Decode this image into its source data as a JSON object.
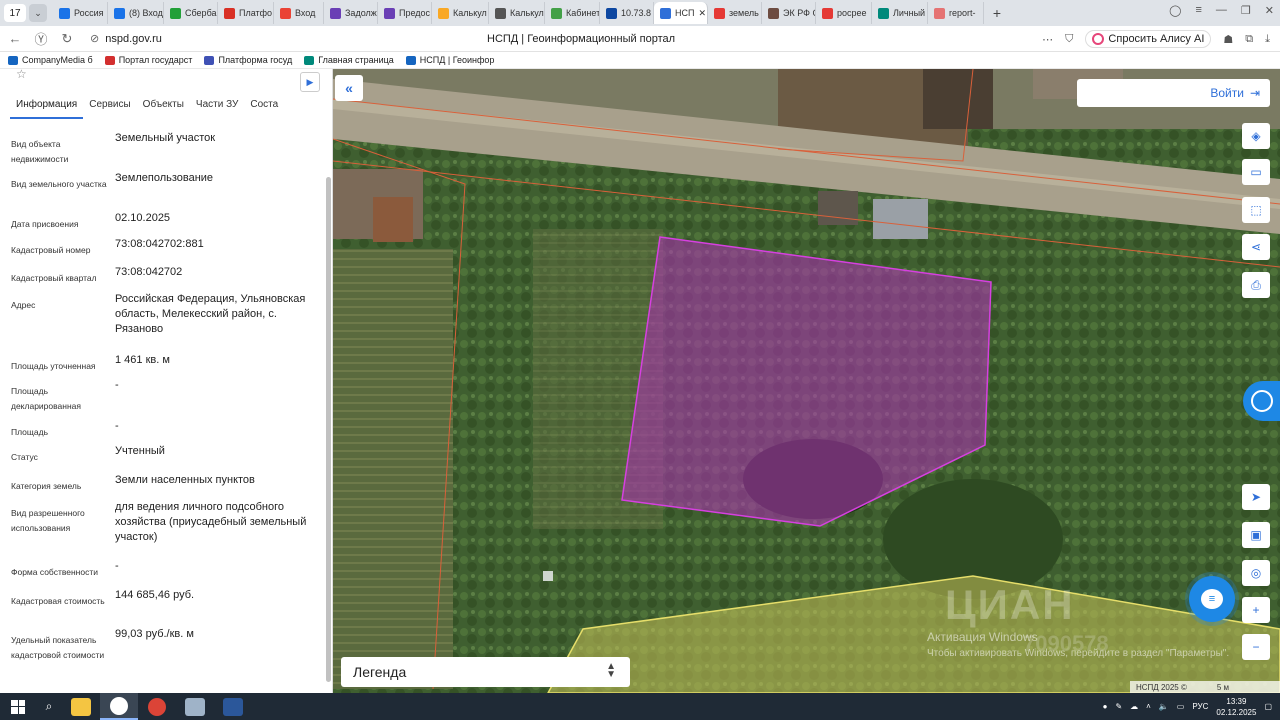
{
  "browser": {
    "tab_counter": "17",
    "tabs": [
      {
        "label": "Россия",
        "color": "#1a73e8"
      },
      {
        "label": "(8) Вход",
        "color": "#1a73e8"
      },
      {
        "label": "Сберба",
        "color": "#21a038"
      },
      {
        "label": "Платфо",
        "color": "#d93025"
      },
      {
        "label": "Вход",
        "color": "#ea4335"
      },
      {
        "label": "Задолж",
        "color": "#6a3fb5"
      },
      {
        "label": "Предос",
        "color": "#6a3fb5"
      },
      {
        "label": "Калькул",
        "color": "#f9a825"
      },
      {
        "label": "Калькул",
        "color": "#555555"
      },
      {
        "label": "Кабинет",
        "color": "#43a047"
      },
      {
        "label": "10.73.8",
        "color": "#0d47a1"
      },
      {
        "label": "НСП",
        "color": "#2f6fd8",
        "active": true
      },
      {
        "label": "земель",
        "color": "#e53935"
      },
      {
        "label": "ЭК РФ С",
        "color": "#6d4c41"
      },
      {
        "label": "росрее",
        "color": "#e53935"
      },
      {
        "label": "Личный",
        "color": "#00897b"
      },
      {
        "label": "report-",
        "color": "#e57373"
      }
    ],
    "tab_close": "✕",
    "tab_add": "+",
    "url": "nspd.gov.ru",
    "page_title": "НСПД | Геоинформационный портал",
    "alisa_label": "Спросить Алису AI",
    "bookmarks": [
      {
        "label": "CompanyMedia б",
        "color": "#1565c0"
      },
      {
        "label": "Портал государст",
        "color": "#d32f2f"
      },
      {
        "label": "Платформа госуд",
        "color": "#3f51b5"
      },
      {
        "label": "Главная страница",
        "color": "#00897b"
      },
      {
        "label": "НСПД | Геоинфор",
        "color": "#1565c0"
      }
    ]
  },
  "panel": {
    "tabs": [
      "Информация",
      "Сервисы",
      "Объекты",
      "Части ЗУ",
      "Соста"
    ],
    "active_tab": "Информация",
    "properties": [
      {
        "label": "Вид объекта недвижимости",
        "value": "Земельный участок"
      },
      {
        "label": "Вид земельного участка",
        "value": "Землепользование"
      },
      {
        "label": "Дата присвоения",
        "value": "02.10.2025"
      },
      {
        "label": "Кадастровый номер",
        "value": "73:08:042702:881"
      },
      {
        "label": "Кадастровый квартал",
        "value": "73:08:042702"
      },
      {
        "label": "Адрес",
        "value": "Российская Федерация, Ульяновская область, Мелекесский район, с. Рязаново"
      },
      {
        "label": "Площадь уточненная",
        "value": "1 461 кв. м"
      },
      {
        "label": "Площадь декларированная",
        "value": "-"
      },
      {
        "label": "Площадь",
        "value": "-"
      },
      {
        "label": "Статус",
        "value": "Учтенный"
      },
      {
        "label": "Категория земель",
        "value": "Земли населенных пунктов"
      },
      {
        "label": "Вид разрешенного использования",
        "value": "для ведения личного подсобного хозяйства (приусадебный земельный участок)"
      },
      {
        "label": "Форма собственности",
        "value": "-"
      },
      {
        "label": "Кадастровая стоимость",
        "value": "144 685,46 руб."
      },
      {
        "label": "Удельный показатель кадастровой стоимости",
        "value": "99,03 руб./кв. м"
      }
    ]
  },
  "map": {
    "login_label": "Войти",
    "legend_label": "Легенда",
    "tools": [
      "layers-icon",
      "ruler-icon",
      "select-area-icon",
      "share-icon",
      "print-icon",
      "locate-icon",
      "minimap-icon",
      "geo-icon",
      "zoom-in-icon",
      "zoom-out-icon"
    ],
    "watermark_cian": "ЦИАН",
    "watermark_id": "7090578",
    "windows_activation_title": "Активация Windows",
    "windows_activation_text": "Чтобы активировать Windows, перейдите в раздел \"Параметры\".",
    "copyright": "НСПД 2025 ©",
    "scale": "5 м",
    "parcel_color": "#b02fb8"
  },
  "taskbar": {
    "language": "РУС",
    "time": "13:39",
    "date": "02.12.2025"
  }
}
